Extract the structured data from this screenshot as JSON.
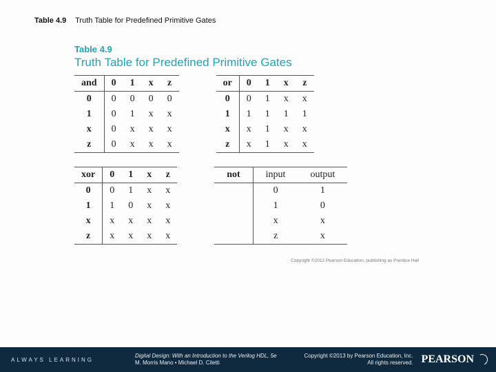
{
  "caption": {
    "num": "Table 4.9",
    "text": "Truth Table for Predefined Primitive Gates"
  },
  "figure": {
    "label": "Table 4.9",
    "title": "Truth Table for Predefined Primitive Gates",
    "inner_copyright": "Copyright ©2012 Pearson Education, publishing as Prentice Hall"
  },
  "gates": {
    "and": {
      "name": "and",
      "cols": [
        "0",
        "1",
        "x",
        "z"
      ],
      "rows": [
        "0",
        "1",
        "x",
        "z"
      ],
      "cells": [
        [
          "0",
          "0",
          "0",
          "0"
        ],
        [
          "0",
          "1",
          "x",
          "x"
        ],
        [
          "0",
          "x",
          "x",
          "x"
        ],
        [
          "0",
          "x",
          "x",
          "x"
        ]
      ]
    },
    "or": {
      "name": "or",
      "cols": [
        "0",
        "1",
        "x",
        "z"
      ],
      "rows": [
        "0",
        "1",
        "x",
        "z"
      ],
      "cells": [
        [
          "0",
          "1",
          "x",
          "x"
        ],
        [
          "1",
          "1",
          "1",
          "1"
        ],
        [
          "x",
          "1",
          "x",
          "x"
        ],
        [
          "x",
          "1",
          "x",
          "x"
        ]
      ]
    },
    "xor": {
      "name": "xor",
      "cols": [
        "0",
        "1",
        "x",
        "z"
      ],
      "rows": [
        "0",
        "1",
        "x",
        "z"
      ],
      "cells": [
        [
          "0",
          "1",
          "x",
          "x"
        ],
        [
          "1",
          "0",
          "x",
          "x"
        ],
        [
          "x",
          "x",
          "x",
          "x"
        ],
        [
          "x",
          "x",
          "x",
          "x"
        ]
      ]
    },
    "not": {
      "name": "not",
      "in_label": "input",
      "out_label": "output",
      "rows": [
        {
          "in": "0",
          "out": "1"
        },
        {
          "in": "1",
          "out": "0"
        },
        {
          "in": "x",
          "out": "x"
        },
        {
          "in": "z",
          "out": "x"
        }
      ]
    }
  },
  "footer": {
    "always": "ALWAYS LEARNING",
    "book_title": "Digital Design: With an Introduction to the Verilog HDL, 5e",
    "book_authors": "M. Morris Mano • Michael D. Ciletti",
    "copyright_line1": "Copyright ©2013 by Pearson Education, Inc.",
    "copyright_line2": "All rights reserved.",
    "brand": "PEARSON"
  }
}
